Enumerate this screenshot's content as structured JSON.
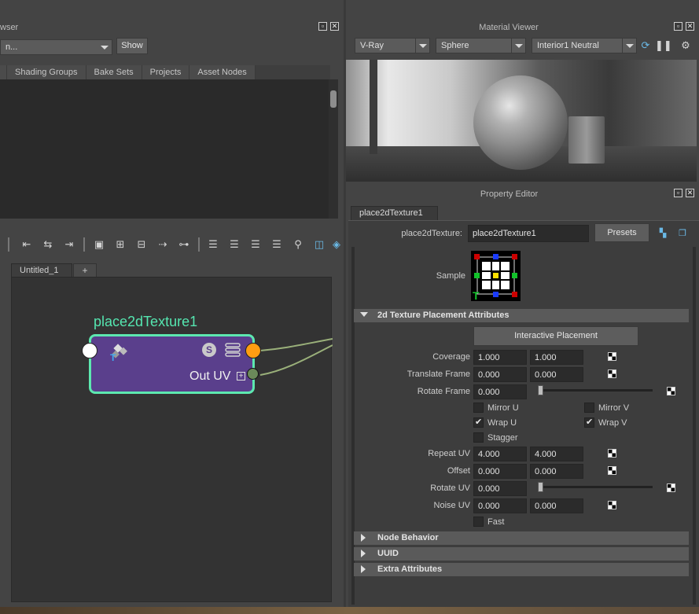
{
  "hypershade": {
    "panel_title": "wser",
    "filter_value": "n...",
    "show_label": "Show",
    "tabs": [
      "Shading Groups",
      "Bake Sets",
      "Projects",
      "Asset Nodes"
    ],
    "editor_tab": "Untitled_1",
    "add_tab": "+",
    "node": {
      "title": "place2dTexture1",
      "out_label": "Out UV",
      "badge": "S"
    }
  },
  "material_viewer": {
    "title": "Material Viewer",
    "renderer": "V-Ray",
    "shape": "Sphere",
    "environment": "Interior1 Neutral"
  },
  "property_editor": {
    "title": "Property Editor",
    "tab": "place2dTexture1",
    "node_label": "place2dTexture:",
    "node_name": "place2dTexture1",
    "presets_label": "Presets",
    "sample_label": "Sample",
    "section_placement": "2d Texture Placement Attributes",
    "interactive_placement": "Interactive Placement",
    "coverage": {
      "label": "Coverage",
      "u": "1.000",
      "v": "1.000"
    },
    "translate_frame": {
      "label": "Translate Frame",
      "u": "0.000",
      "v": "0.000"
    },
    "rotate_frame": {
      "label": "Rotate Frame",
      "value": "0.000"
    },
    "mirror_u": {
      "label": "Mirror U",
      "checked": false
    },
    "mirror_v": {
      "label": "Mirror V",
      "checked": false
    },
    "wrap_u": {
      "label": "Wrap U",
      "checked": true
    },
    "wrap_v": {
      "label": "Wrap V",
      "checked": true
    },
    "stagger": {
      "label": "Stagger",
      "checked": false
    },
    "repeat_uv": {
      "label": "Repeat UV",
      "u": "4.000",
      "v": "4.000"
    },
    "offset": {
      "label": "Offset",
      "u": "0.000",
      "v": "0.000"
    },
    "rotate_uv": {
      "label": "Rotate UV",
      "value": "0.000"
    },
    "noise_uv": {
      "label": "Noise UV",
      "u": "0.000",
      "v": "0.000"
    },
    "fast": {
      "label": "Fast",
      "checked": false
    },
    "sections_collapsed": [
      "Node Behavior",
      "UUID",
      "Extra Attributes"
    ]
  },
  "colors": {
    "node_fill": "#5a3f8c",
    "node_border": "#5de8b0",
    "node_title": "#55e6b0",
    "out_port": "#ff9d12",
    "uv_port": "#6b8a5a"
  }
}
